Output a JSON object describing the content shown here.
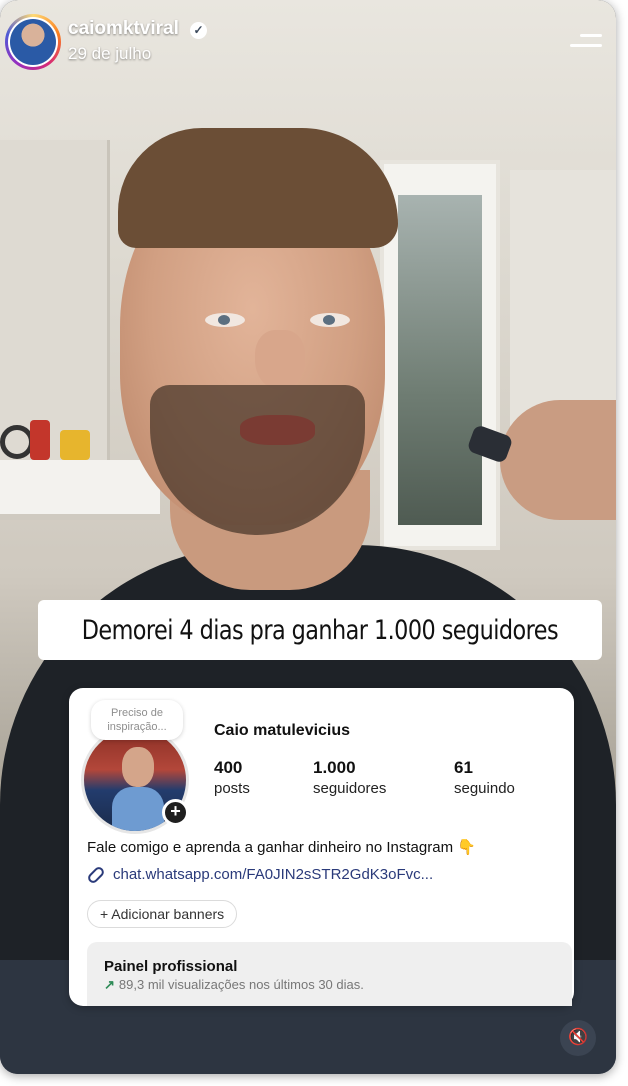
{
  "header": {
    "username": "caiomktviral",
    "date": "29 de julho",
    "verified_icon": "verified-check-icon",
    "menu_icon": "menu-icon"
  },
  "caption": {
    "text": "Demorei 4 dias pra ganhar 1.000 seguidores"
  },
  "profile_card": {
    "note": "Preciso de inspiração...",
    "name": "Caio matulevicius",
    "stats": [
      {
        "value": "400",
        "label": "posts"
      },
      {
        "value": "1.000",
        "label": "seguidores"
      },
      {
        "value": "61",
        "label": "seguindo"
      }
    ],
    "bio": "Fale comigo e aprenda a ganhar dinheiro no Instagram 👇",
    "link": "chat.whatsapp.com/FA0JIN2sSTR2GdK3oFvc...",
    "add_banners": "+ Adicionar banners",
    "painel_title": "Painel profissional",
    "painel_arrow": "↗",
    "painel_sub": "89,3 mil visualizações nos últimos 30 dias."
  },
  "controls": {
    "mute_icon": "muted-speaker-icon",
    "mute_glyph": "🔇"
  }
}
